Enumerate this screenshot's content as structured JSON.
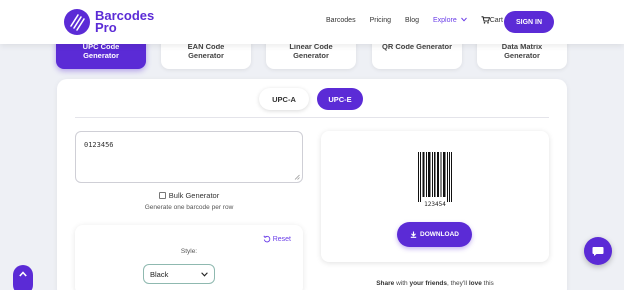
{
  "nav": {
    "logo_line1": "Barcodes",
    "logo_line2": "Pro",
    "links": [
      "Barcodes",
      "Pricing",
      "Blog"
    ],
    "explore": "Explore",
    "cart": "Cart",
    "signin": "SIGN IN"
  },
  "tools": [
    {
      "line1": "UPC Code",
      "line2": "Generator"
    },
    {
      "line1": "EAN Code",
      "line2": "Generator"
    },
    {
      "line1": "Linear Code",
      "line2": "Generator"
    },
    {
      "line1": "QR Code Generator",
      "line2": ""
    },
    {
      "line1": "Data Matrix",
      "line2": "Generator"
    }
  ],
  "type_tabs": [
    "UPC-A",
    "UPC-E"
  ],
  "input": {
    "value": "0123456"
  },
  "bulk": {
    "label": "Bulk Generator",
    "note": "Generate one barcode per row"
  },
  "options": {
    "reset": "Reset",
    "style_label": "Style:",
    "style_value": "Black"
  },
  "preview": {
    "barcode_text": "123454",
    "download": "DOWNLOAD"
  },
  "share": {
    "pre": "Share",
    "mid1": " with ",
    "friends": "your friends",
    "mid2": ", they'll ",
    "love": "love",
    "post": " this"
  },
  "colors": {
    "accent": "#5b2bd6",
    "link_accent": "#6a3de8"
  }
}
